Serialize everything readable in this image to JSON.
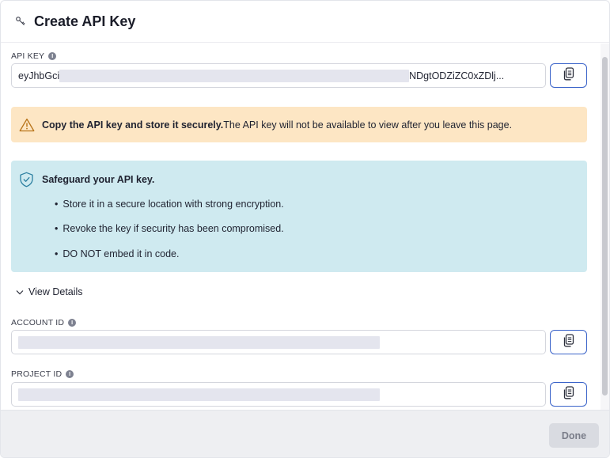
{
  "dialog": {
    "title": "Create API Key",
    "key_icon": "key-icon"
  },
  "api_key": {
    "label": "API KEY",
    "prefix": "eyJhbGci",
    "suffix": "NDgtODZiZC0xZDlj...",
    "copy_icon": "copy-icon"
  },
  "warning": {
    "icon": "warning-icon",
    "bold": "Copy the API key and store it securely.",
    "text": "The API key will not be available to view after you leave this page.",
    "bg": "#fde6c4"
  },
  "safeguard": {
    "icon": "shield-check-icon",
    "title": "Safeguard your API key.",
    "bullets": [
      "Store it in a secure location with strong encryption.",
      "Revoke the key if security has been compromised.",
      "DO NOT embed it in code."
    ],
    "bg": "#cfeaf0"
  },
  "view_details": {
    "label": "View Details",
    "icon": "chevron-down-icon"
  },
  "account_id": {
    "label": "ACCOUNT ID"
  },
  "project_id": {
    "label": "PROJECT ID"
  },
  "footer": {
    "done_label": "Done"
  },
  "colors": {
    "accent": "#3a63c9",
    "done_bg": "#d9dbe1"
  }
}
